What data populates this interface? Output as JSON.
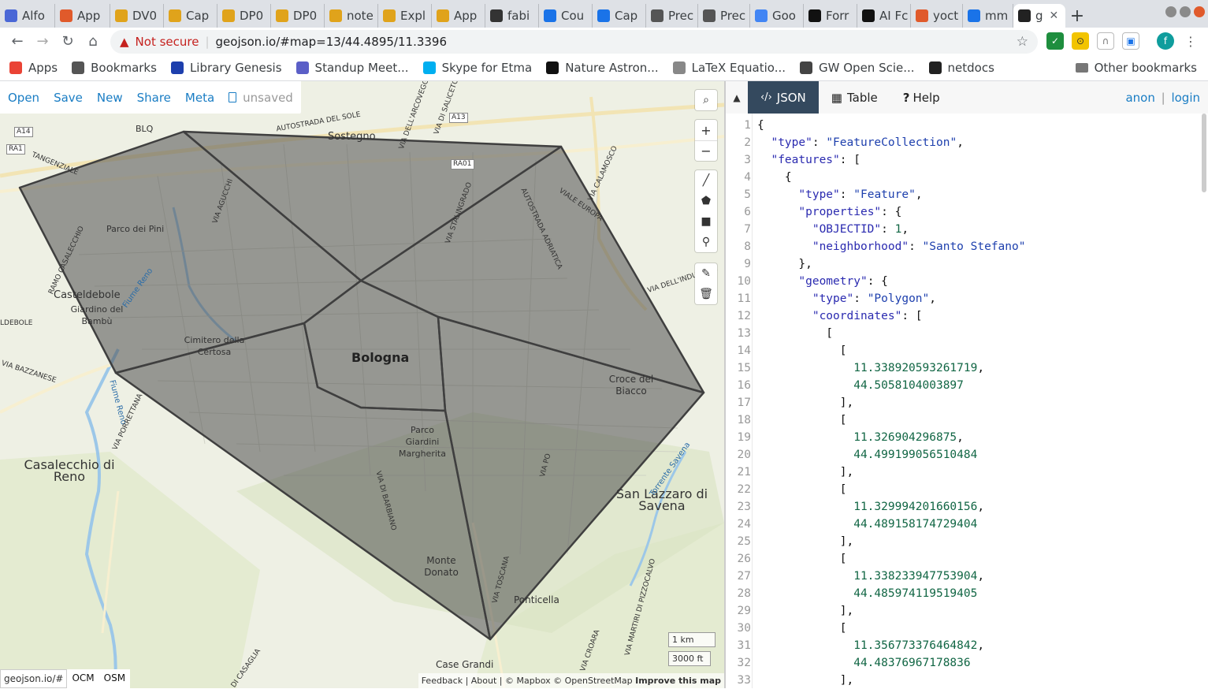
{
  "browser": {
    "tabs": [
      {
        "label": "Alfo",
        "color": "#4a67d6"
      },
      {
        "label": "App",
        "color": "#e05a2b"
      },
      {
        "label": "DV0",
        "color": "#e0a31b"
      },
      {
        "label": "Cap",
        "color": "#e0a31b"
      },
      {
        "label": "DP0",
        "color": "#e0a31b"
      },
      {
        "label": "DP0",
        "color": "#e0a31b"
      },
      {
        "label": "note",
        "color": "#e0a31b"
      },
      {
        "label": "Expl",
        "color": "#e0a31b"
      },
      {
        "label": "App",
        "color": "#e0a31b"
      },
      {
        "label": "fabi",
        "color": "#333333"
      },
      {
        "label": "Cou",
        "color": "#1a73e8"
      },
      {
        "label": "Cap",
        "color": "#1a73e8"
      },
      {
        "label": "Prec",
        "color": "#555555"
      },
      {
        "label": "Prec",
        "color": "#555555"
      },
      {
        "label": "Goo",
        "color": "#4285f4"
      },
      {
        "label": "Forr",
        "color": "#111111"
      },
      {
        "label": "AI Fc",
        "color": "#111111"
      },
      {
        "label": "yoct",
        "color": "#e05a2b"
      },
      {
        "label": "mm",
        "color": "#1a73e8"
      },
      {
        "label": "g",
        "color": "#222222"
      }
    ],
    "new_tab": "+",
    "nav": {
      "back": "←",
      "forward": "→",
      "reload": "↻",
      "home": "⌂"
    },
    "security": {
      "icon": "warning-icon",
      "label": "Not secure"
    },
    "url": "geojson.io/#map=13/44.4895/11.3396",
    "bookmarks": [
      {
        "label": "Apps",
        "color": "#ea4335"
      },
      {
        "label": "Bookmarks",
        "color": "#555555"
      },
      {
        "label": "Library Genesis",
        "color": "#1d3fad"
      },
      {
        "label": "Standup Meet...",
        "color": "#5b5fc7"
      },
      {
        "label": "Skype for Etma",
        "color": "#00aff0"
      },
      {
        "label": "Nature Astron...",
        "color": "#111111"
      },
      {
        "label": "LaTeX Equatio...",
        "color": "#888888"
      },
      {
        "label": "GW Open Scie...",
        "color": "#444444"
      },
      {
        "label": "netdocs",
        "color": "#222222"
      }
    ],
    "other_bookmarks": "Other bookmarks"
  },
  "app": {
    "menu": [
      "Open",
      "Save",
      "New",
      "Share",
      "Meta"
    ],
    "unsaved": "unsaved",
    "panel_tabs": [
      {
        "label": "JSON",
        "icon": "code-icon"
      },
      {
        "label": "Table",
        "icon": "table-icon"
      },
      {
        "label": "Help",
        "icon": "help-icon"
      }
    ],
    "auth": {
      "anon": "anon",
      "separator": "|",
      "login": "login"
    },
    "map_controls": [
      "search-icon",
      "zoom-in-icon",
      "zoom-out-icon",
      "draw-line-icon",
      "draw-polygon-icon",
      "draw-rectangle-icon",
      "draw-marker-icon",
      "edit-layers-icon",
      "delete-layers-icon"
    ],
    "map_labels": {
      "bologna": "Bologna",
      "sostegno": "Sostegno",
      "casteldebole": "Casteldebole",
      "parco_pini": "Parco dei Pini",
      "giardino": "Giardino del Bambù",
      "cimitero": "Cimitero della Certosa",
      "casalecchio": "Casalecchio di Reno",
      "croce": "Croce del Biacco",
      "san_lazzaro": "San Lazzaro di Savena",
      "parco_margherita": "Parco Giardini Margherita",
      "monte_donato": "Monte Donato",
      "ponticella": "Ponticella",
      "case_grandi": "Case Grandi",
      "blq": "BLQ",
      "a14": "A14",
      "ra1": "RA1",
      "a13": "A13",
      "ra01": "RA01",
      "tangenziale": "TANGENZIALE",
      "via_stalingrado": "VIA STALINGRADO",
      "via_gucchi": "VIA AGUCCHI",
      "autostrada_adriatica": "AUTOSTRADA ADRIATICA",
      "viale_europa": "VIALE EUROPA",
      "via_calamosco": "VIA CALAMOSCO",
      "autostrada_sole": "AUTOSTRADA DEL SOLE",
      "via_industria": "VIA DELL'INDUSTRIA",
      "via_arcoveggio": "VIA DELL'ARCOVEGGIO",
      "via_saliceto": "VIA DI SALICETO",
      "fiume_reno": "Fiume Reno",
      "via_porrettana": "VIA PORRETTANA",
      "via_bazzanese": "VIA BAZZANESE",
      "via_barbiano": "VIA DI BARBIANO",
      "via_toscana": "VIA TOSCANA",
      "via_po": "VIA PO",
      "torrente_savena": "Torrente Savena",
      "via_croara": "VIA CROARA",
      "via_martiri": "VIA MARTIRI DI PIZZOCALVO",
      "via_casaglia": "VIA DI CASAGLIA",
      "aldebole": "LDEBOLE",
      "ramo": "RAMO CASALECCHIO"
    },
    "scale": {
      "metric": "1 km",
      "imperial": "3000 ft"
    },
    "attribution": {
      "text": "Feedback | About | © Mapbox © OpenStreetMap",
      "improve": "Improve this map"
    },
    "layers": {
      "source": "geojson.io/#",
      "options": [
        "OCM",
        "OSM"
      ]
    },
    "json_lines": [
      {
        "n": "1",
        "t": "{"
      },
      {
        "n": "2",
        "t": "  \"type\": \"FeatureCollection\","
      },
      {
        "n": "3",
        "t": "  \"features\": ["
      },
      {
        "n": "4",
        "t": "    {"
      },
      {
        "n": "5",
        "t": "      \"type\": \"Feature\","
      },
      {
        "n": "6",
        "t": "      \"properties\": {"
      },
      {
        "n": "7",
        "t": "        \"OBJECTID\": 1,"
      },
      {
        "n": "8",
        "t": "        \"neighborhood\": \"Santo Stefano\""
      },
      {
        "n": "9",
        "t": "      },"
      },
      {
        "n": "10",
        "t": "      \"geometry\": {"
      },
      {
        "n": "11",
        "t": "        \"type\": \"Polygon\","
      },
      {
        "n": "12",
        "t": "        \"coordinates\": ["
      },
      {
        "n": "13",
        "t": "          ["
      },
      {
        "n": "14",
        "t": "            ["
      },
      {
        "n": "15",
        "t": "              11.338920593261719,"
      },
      {
        "n": "16",
        "t": "              44.5058104003897"
      },
      {
        "n": "17",
        "t": "            ],"
      },
      {
        "n": "18",
        "t": "            ["
      },
      {
        "n": "19",
        "t": "              11.326904296875,"
      },
      {
        "n": "20",
        "t": "              44.499199056510484"
      },
      {
        "n": "21",
        "t": "            ],"
      },
      {
        "n": "22",
        "t": "            ["
      },
      {
        "n": "23",
        "t": "              11.329994201660156,"
      },
      {
        "n": "24",
        "t": "              44.489158174729404"
      },
      {
        "n": "25",
        "t": "            ],"
      },
      {
        "n": "26",
        "t": "            ["
      },
      {
        "n": "27",
        "t": "              11.338233947753904,"
      },
      {
        "n": "28",
        "t": "              44.485974119519405"
      },
      {
        "n": "29",
        "t": "            ],"
      },
      {
        "n": "30",
        "t": "            ["
      },
      {
        "n": "31",
        "t": "              11.356773376464842,"
      },
      {
        "n": "32",
        "t": "              44.48376967178836"
      },
      {
        "n": "33",
        "t": "            ],"
      }
    ],
    "colors": {
      "accent": "#1a7dc4",
      "tab_active": "#34495e",
      "polygon_fill": "#555555",
      "polygon_stroke": "#444444",
      "map_bg": "#eef0e4"
    }
  }
}
